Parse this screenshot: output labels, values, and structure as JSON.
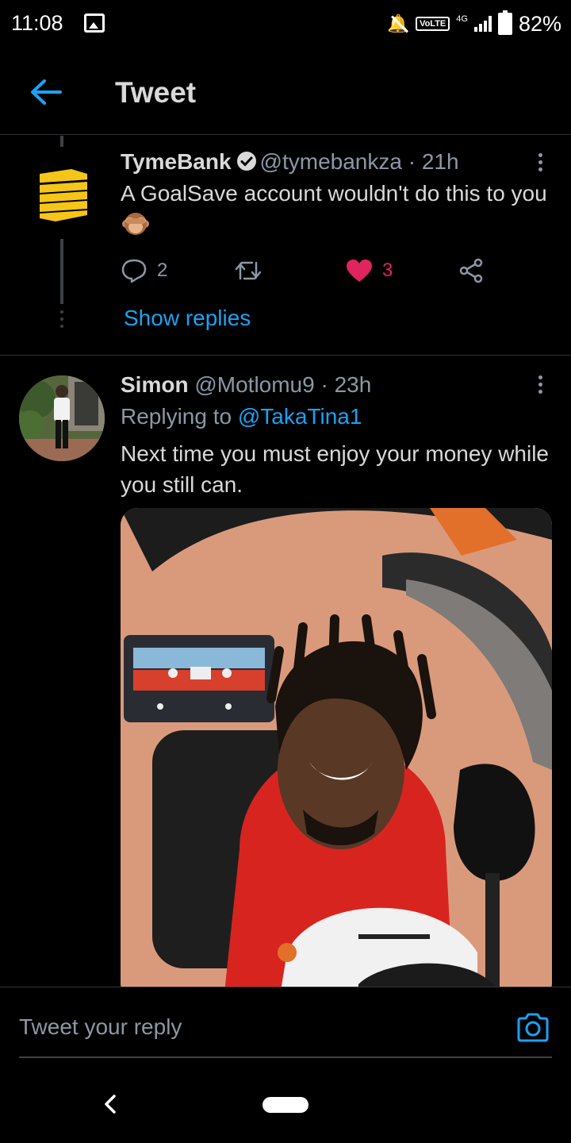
{
  "status_bar": {
    "time": "11:08",
    "network_badge": "VoLTE",
    "network_type": "4G",
    "battery": "82%"
  },
  "header": {
    "title": "Tweet"
  },
  "tweets": [
    {
      "display_name": "TymeBank",
      "handle": "@tymebankza",
      "time": "· 21h",
      "text": "A GoalSave account wouldn't do this to you",
      "replies": "2",
      "likes": "3",
      "show_replies": "Show replies"
    },
    {
      "display_name": "Simon",
      "handle": "@Motlomu9",
      "time": "· 23h",
      "replying_prefix": "Replying to",
      "replying_to": "@TakaTina1",
      "text": "Next time you must enjoy your money while you still can."
    }
  ],
  "composer": {
    "placeholder": "Tweet your reply"
  },
  "colors": {
    "accent": "#1da1f2",
    "like": "#e0245e",
    "tymebank_gold": "#f5c518"
  }
}
